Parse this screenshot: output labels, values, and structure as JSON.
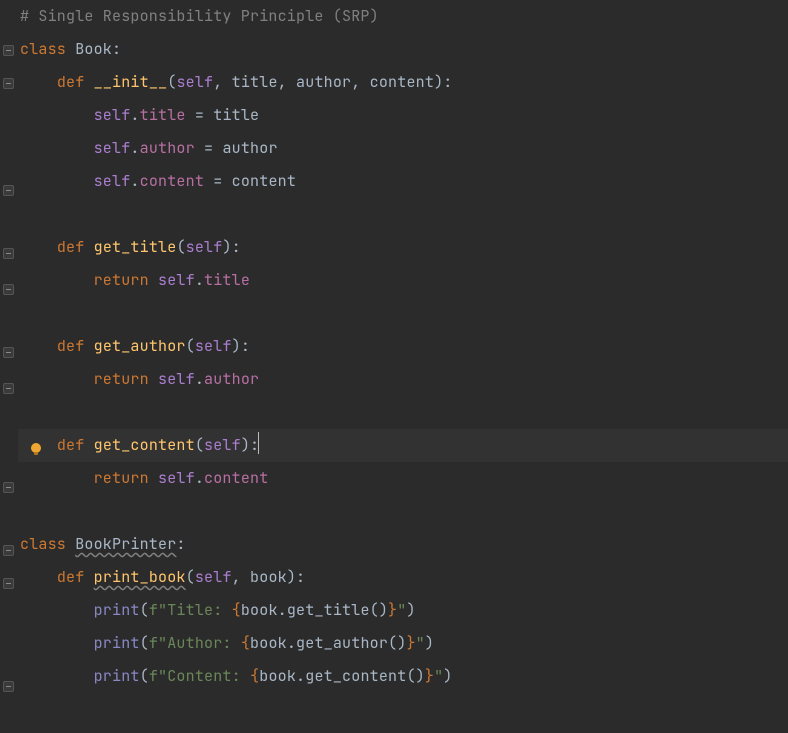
{
  "lines": {
    "comment": "# Single Responsibility Principle (SRP)",
    "class1": {
      "kw": "class ",
      "name": "Book",
      "colon": ":"
    },
    "def_init": {
      "indent": "    ",
      "kw": "def ",
      "name": "__init__",
      "open": "(",
      "p_self": "self",
      "rest": ", title, author, content",
      "close": "):"
    },
    "init_title": {
      "indent": "        ",
      "self": "self",
      "dot": ".",
      "attr": "title",
      "eq": " = ",
      "rhs": "title"
    },
    "init_author": {
      "indent": "        ",
      "self": "self",
      "dot": ".",
      "attr": "author",
      "eq": " = ",
      "rhs": "author"
    },
    "init_content": {
      "indent": "        ",
      "self": "self",
      "dot": ".",
      "attr": "content",
      "eq": " = ",
      "rhs": "content"
    },
    "def_gettitle": {
      "indent": "    ",
      "kw": "def ",
      "name": "get_title",
      "open": "(",
      "p_self": "self",
      "close": "):"
    },
    "ret_title": {
      "indent": "        ",
      "kw": "return ",
      "self": "self",
      "dot": ".",
      "attr": "title"
    },
    "def_getauthor": {
      "indent": "    ",
      "kw": "def ",
      "name": "get_author",
      "open": "(",
      "p_self": "self",
      "close": "):"
    },
    "ret_author": {
      "indent": "        ",
      "kw": "return ",
      "self": "self",
      "dot": ".",
      "attr": "author"
    },
    "def_getcontent": {
      "indent": "    ",
      "kw": "def ",
      "name": "get_content",
      "open": "(",
      "p_self": "self",
      "close": "):"
    },
    "ret_content": {
      "indent": "        ",
      "kw": "return ",
      "self": "self",
      "dot": ".",
      "attr": "content"
    },
    "class2": {
      "kw": "class ",
      "name": "BookPrinter",
      "colon": ":"
    },
    "def_printbook": {
      "indent": "    ",
      "kw": "def ",
      "name": "print_book",
      "open": "(",
      "p_self": "self",
      "rest": ", book",
      "close": "):"
    },
    "p1": {
      "indent": "        ",
      "call": "print",
      "open": "(",
      "f": "f",
      "s1": "\"Title: ",
      "br_o": "{",
      "expr": "book.get_title()",
      "br_c": "}",
      "s2": "\"",
      "close": ")"
    },
    "p2": {
      "indent": "        ",
      "call": "print",
      "open": "(",
      "f": "f",
      "s1": "\"Author: ",
      "br_o": "{",
      "expr": "book.get_author()",
      "br_c": "}",
      "s2": "\"",
      "close": ")"
    },
    "p3": {
      "indent": "        ",
      "call": "print",
      "open": "(",
      "f": "f",
      "s1": "\"Content: ",
      "br_o": "{",
      "expr": "book.get_content()",
      "br_c": "}",
      "s2": "\"",
      "close": ")"
    }
  }
}
